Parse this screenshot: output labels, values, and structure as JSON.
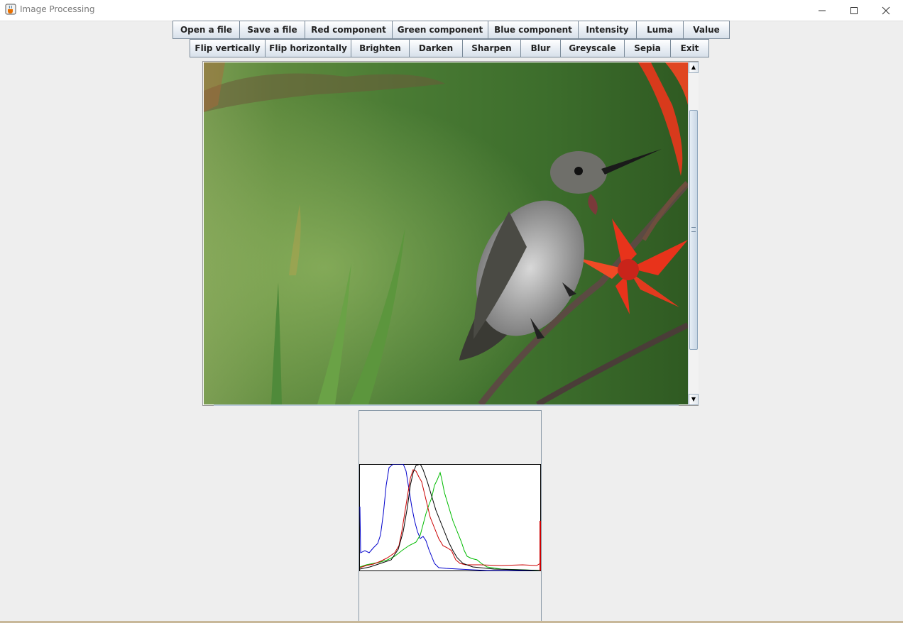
{
  "window": {
    "title": "Image Processing",
    "icons": {
      "app": "java-cup-icon",
      "minimize": "minimize-icon",
      "maximize": "maximize-icon",
      "close": "close-icon"
    }
  },
  "toolbar": {
    "row1": [
      "Open a file",
      "Save a file",
      "Red component",
      "Green component",
      "Blue component",
      "Intensity",
      "Luma",
      "Value"
    ],
    "row2": [
      "Flip vertically",
      "Flip horizontally",
      "Brighten",
      "Darken",
      "Sharpen",
      "Blur",
      "Greyscale",
      "Sepia",
      "Exit"
    ]
  },
  "image": {
    "subject": "hummingbird-on-red-flower",
    "scrollbar_position": 0.3
  },
  "histogram": {
    "colors": {
      "red": "#d00000",
      "green": "#00cc00",
      "blue": "#0000cc",
      "intensity": "#000000"
    }
  }
}
